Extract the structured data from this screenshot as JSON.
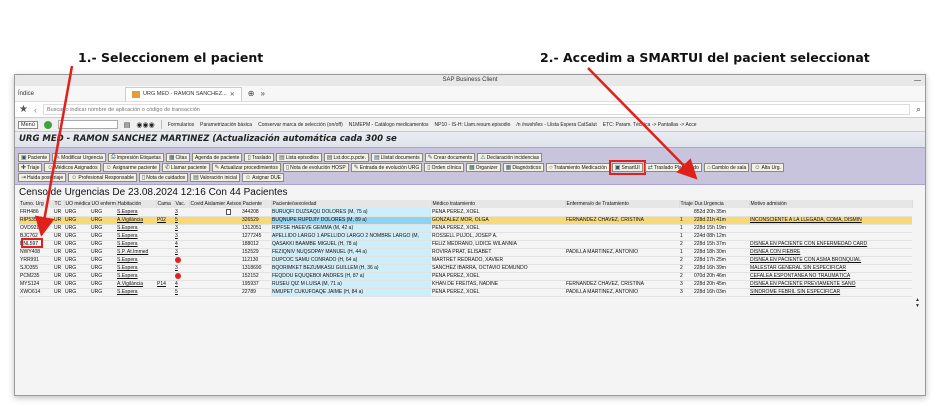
{
  "annotations": {
    "step1": "1.- Seleccionem el pacient",
    "step2": "2.- Accedim a SMARTUI del pacient seleccionat"
  },
  "window": {
    "title": "SAP Business Client",
    "tab_home": "Índice",
    "tab_active": "URG MED - RAMON SANCHEZ...",
    "address_placeholder": "Buscar o indicar nombre de aplicación o código de transacción"
  },
  "menubar": {
    "menu": "Menú",
    "items": [
      "Formularios",
      "Parametrización básica",
      "Conservar marca de selección (on/off)",
      "N1MEPM - Catálogo medicamentos",
      "NP10 - IS-H: Llam.resum.episodio",
      "/n /nwsh/les - Llista Espera CatSalut",
      "ETC: Param. Técnica -> Pantallas -> Acce"
    ]
  },
  "heading": "URG MED - RAMON SANCHEZ MARTINEZ (Actualización automática cada 300 se",
  "toolbar": {
    "row1": [
      "Paciente",
      "Modificar Urgencia",
      "Impresión Etiquetas",
      "Citas",
      "Agenda de paciente",
      "Traslado",
      "Lista episodios",
      "Lst.doc.p.pcte.",
      "Llistat documents",
      "Crear documento",
      "Declaración incidencias"
    ],
    "row2": [
      "Triaje",
      "Médicos Asignados",
      "Asignarme paciente",
      "Llamar paciente",
      "Actualizar procedimientos",
      "Nota de evolución HOSP",
      "Entrada de evolución URG",
      "Orden clínica",
      "Organizer",
      "Diagnósticos",
      "Tratamiento Medicación",
      "SmartUI",
      "Traslado Planificado",
      "Cambio de sala",
      "Alta Urg."
    ],
    "row3": [
      "Huida post triaje",
      "Profesional Responsable",
      "Nota de cuidados",
      "Valoración inicial",
      "Asignar DUE"
    ]
  },
  "census_title": "Censo de Urgencias De 23.08.2024 12:16 Con  44 Pacientes",
  "table": {
    "headers": [
      "Turno. Urg",
      "TC",
      "UO médica",
      "UO enferm.",
      "Habitación",
      "Cama",
      "Vac.",
      "Covid",
      "Aislamien.",
      "Avisos cl",
      "Paciente",
      "Paciente/sexo/edad",
      "Médico tratamiento",
      "Enfermera/o de Tratamiento",
      "Triaje",
      "Dur.Urgencia",
      "Motivo admisión"
    ],
    "rows": [
      {
        "turno": "FRH486",
        "tc": "UR",
        "uom": "URG",
        "uoe": "URG",
        "hab": "S.Espera",
        "cama": "",
        "vac": "3",
        "covid": "",
        "ais": "",
        "avisos": "doc",
        "pac": "344208",
        "nombre": "BURUQFI DUZSAQU DOLORES (M, 75 a)",
        "medico": "PENA PEREZ, XOEL",
        "enf": "",
        "triaje": "",
        "dur": "852d 20h 35m",
        "motivo": "",
        "sel": false
      },
      {
        "turno": "RIP535",
        "tc": "UR",
        "uom": "URG",
        "uoe": "URG",
        "hab": "A.Vigilància",
        "cama": "P02",
        "vac": "5",
        "covid": "",
        "ais": "",
        "avisos": "",
        "pac": "326529",
        "nombre": "BUQNUPE RUPDJIY DOLORES (M, 89 a)",
        "medico": "GONZALEZ MOR, OLGA",
        "enf": "FERNANDEZ CHAVEZ, CRISTINA",
        "triaje": "1",
        "dur": "228d 21h 41m",
        "motivo": "INCONSCIENTE A LA LLEGADA, COMA, DISMIN",
        "sel": true
      },
      {
        "turno": "OVD921",
        "tc": "UR",
        "uom": "URG",
        "uoe": "URG",
        "hab": "S.Espera",
        "cama": "",
        "vac": "3",
        "covid": "",
        "ais": "",
        "avisos": "",
        "pac": "1312051",
        "nombre": "RIPFSE HAEEVE GEMMA (M, 42 a)",
        "medico": "PENA PEREZ, XOEL",
        "enf": "",
        "triaje": "1",
        "dur": "228d 15h 19m",
        "motivo": "",
        "sel": false
      },
      {
        "turno": "BJC762",
        "tc": "UR",
        "uom": "URG",
        "uoe": "URG",
        "hab": "S.Espera",
        "cama": "",
        "vac": "3",
        "covid": "",
        "ais": "",
        "avisos": "",
        "pac": "1277245",
        "nombre": "APELLIDO LARGO 1 APELLIDO LARGO 2 NOMBRE LARGO (M,",
        "medico": "ROSSELL PUJOL, JOSEP A.",
        "enf": "",
        "triaje": "1",
        "dur": "224d 08h 12m",
        "motivo": "",
        "sel": false
      },
      {
        "turno": "BNL597",
        "tc": "UR",
        "uom": "URG",
        "uoe": "URG",
        "hab": "S.Espera",
        "cama": "",
        "vac": "4",
        "covid": "",
        "ais": "",
        "avisos": "",
        "pac": "188012",
        "nombre": "QASAKKI BAAMBE MIGUEL (H, 78 a)",
        "medico": "FELIZ MEDRANO, LIDICE WILANNIA",
        "enf": "",
        "triaje": "2",
        "dur": "228d 15h 37m",
        "motivo": "DISNEA EN PACIENTE CON ENFERMEDAD CARD",
        "sel": false
      },
      {
        "turno": "NWY408",
        "tc": "UR",
        "uom": "URG",
        "uoe": "URG",
        "hab": "S.P. At.Immed",
        "cama": "",
        "vac": "3",
        "covid": "",
        "ais": "",
        "avisos": "",
        "pac": "152529",
        "nombre": "FEZIQNIV NUQSOPAY MANUEL (H, 44 a)",
        "medico": "ROVIRA PRAT, ELISABET",
        "enf": "PADILLA MARTINEZ, ANTONIO",
        "triaje": "1",
        "dur": "228d 18h 30m",
        "motivo": "DISNEA CON FIEBRE",
        "sel": false
      },
      {
        "turno": "YRR991",
        "tc": "UR",
        "uom": "URG",
        "uoe": "URG",
        "hab": "S.Espera",
        "cama": "",
        "vac": "dot",
        "covid": "",
        "ais": "",
        "avisos": "",
        "pac": "112130",
        "nombre": "DUPCOC SAMU CONRADO (H, 64 a)",
        "medico": "MARTRET REDRADO, XAVIER",
        "enf": "",
        "triaje": "2",
        "dur": "228d 17h 25m",
        "motivo": "DISNEA EN PACIENTE CON ASMA BRONQUIAL",
        "sel": false
      },
      {
        "turno": "SJO355",
        "tc": "UR",
        "uom": "URG",
        "uoe": "URG",
        "hab": "S.Espera",
        "cama": "",
        "vac": "3",
        "covid": "",
        "ais": "",
        "avisos": "",
        "pac": "1318690",
        "nombre": "BQORIMKET BEZUMKASU GUILLEM (H, 36 a)",
        "medico": "SANCHEZ IBARRA, OCTAVIO EDMUNDO",
        "enf": "",
        "triaje": "2",
        "dur": "228d 16h 39m",
        "motivo": "MALESTAR GENERAL SIN ESPECIFICAR",
        "sel": false
      },
      {
        "turno": "PCM235",
        "tc": "UR",
        "uom": "URG",
        "uoe": "URG",
        "hab": "S.Espera",
        "cama": "",
        "vac": "dot",
        "covid": "",
        "ais": "",
        "avisos": "",
        "pac": "152152",
        "nombre": "FEQDOU EQUQEBOI ANDRES (H, 87 a)",
        "medico": "PENA PEREZ, XOEL",
        "enf": "",
        "triaje": "2",
        "dur": "070d 20h 46m",
        "motivo": "CEFALEA ESPONTÁNEA NO TRAUMÁTICA",
        "sel": false
      },
      {
        "turno": "MYS124",
        "tc": "UR",
        "uom": "URG",
        "uoe": "URG",
        "hab": "A.Vigilància",
        "cama": "P14",
        "vac": "4",
        "covid": "",
        "ais": "",
        "avisos": "",
        "pac": "195937",
        "nombre": "RUSEU QIZ M LUISA (M, 71 a)",
        "medico": "KHAN DE FREITAS, NADINE",
        "enf": "FERNANDEZ CHAVEZ, CRISTINA",
        "triaje": "3",
        "dur": "228d 20h 45m",
        "motivo": "DISNEA EN PACIENTE PREVIAMENTE SANO",
        "sel": false
      },
      {
        "turno": "XWO614",
        "tc": "UR",
        "uom": "URG",
        "uoe": "URG",
        "hab": "S.Espera",
        "cama": "",
        "vac": "5",
        "covid": "",
        "ais": "",
        "avisos": "",
        "pac": "22789",
        "nombre": "NMUPET CUKUFOAQE JAIME (H, 84 a)",
        "medico": "PENA PEREZ, XOEL",
        "enf": "PADILLA MARTINEZ, ANTONIO",
        "triaje": "3",
        "dur": "228d 16h 03m",
        "motivo": "SÍNDROME FEBRIL SIN ESPECIFICAR",
        "sel": false
      }
    ]
  }
}
